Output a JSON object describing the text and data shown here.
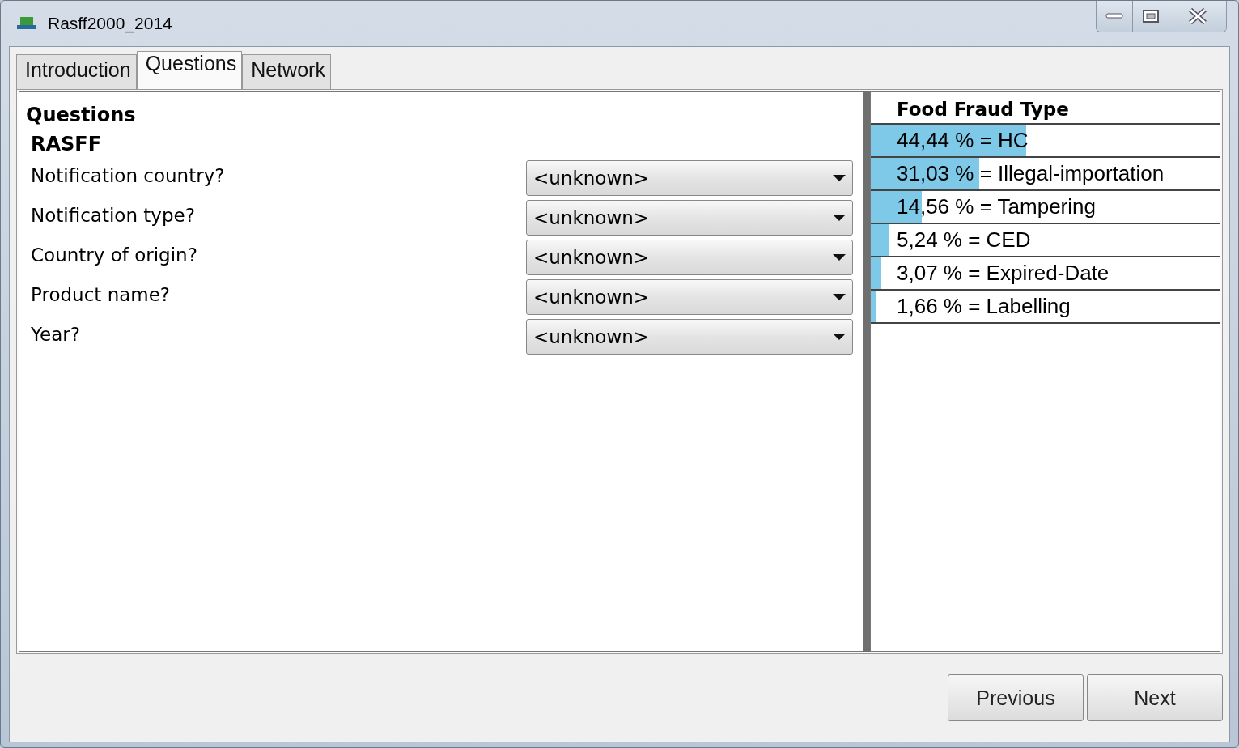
{
  "window": {
    "title": "Rasff2000_2014"
  },
  "tabs": [
    {
      "label": "Introduction",
      "selected": false
    },
    {
      "label": "Questions",
      "selected": true
    },
    {
      "label": "Network",
      "selected": false
    }
  ],
  "questions": {
    "heading": "Questions",
    "section": "RASFF",
    "items": [
      {
        "label": "Notification country?",
        "value": "<unknown>"
      },
      {
        "label": "Notification type?",
        "value": "<unknown>"
      },
      {
        "label": "Country of origin?",
        "value": "<unknown>"
      },
      {
        "label": "Product name?",
        "value": "<unknown>"
      },
      {
        "label": "Year?",
        "value": "<unknown>"
      }
    ]
  },
  "results": {
    "title": "Food Fraud Type",
    "rows": [
      {
        "text": "44,44 % = HC",
        "level": 0.4444
      },
      {
        "text": "31,03 % = Illegal-importation",
        "level": 0.3103
      },
      {
        "text": "14,56 % = Tampering",
        "level": 0.1456
      },
      {
        "text": "5,24 % = CED",
        "level": 0.0524
      },
      {
        "text": "3,07 % = Expired-Date",
        "level": 0.0307
      },
      {
        "text": "1,66 % = Labelling",
        "level": 0.0166
      }
    ]
  },
  "buttons": [
    "Previous",
    "Next"
  ]
}
